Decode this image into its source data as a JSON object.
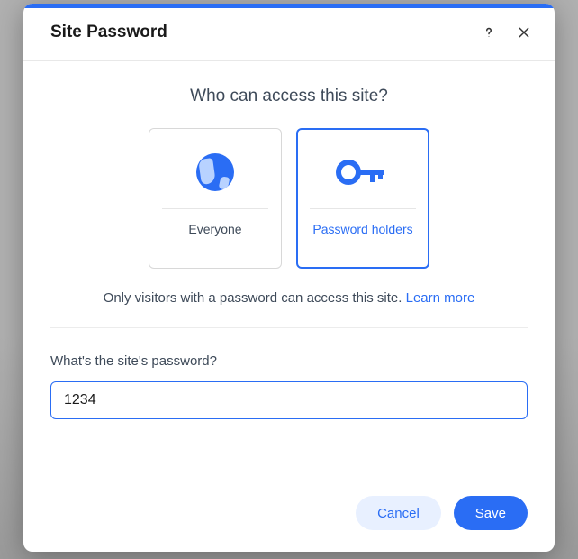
{
  "modal": {
    "title": "Site Password",
    "question": "Who can access this site?",
    "options": {
      "everyone": {
        "label": "Everyone"
      },
      "password_holders": {
        "label": "Password holders"
      }
    },
    "description_prefix": "Only visitors with a password can access this site. ",
    "learn_more": "Learn more",
    "password_label": "What's the site's password?",
    "password_value": "1234",
    "buttons": {
      "cancel": "Cancel",
      "save": "Save"
    }
  }
}
